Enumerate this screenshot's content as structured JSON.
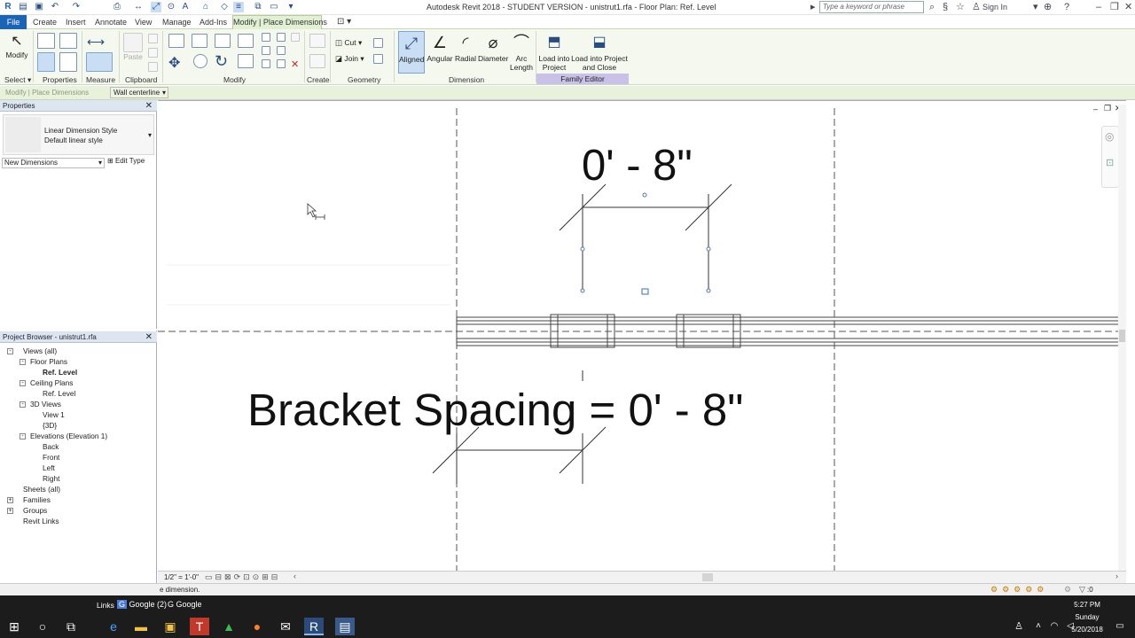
{
  "window": {
    "title": "Autodesk Revit 2018 - STUDENT VERSION -     unistrut1.rfa - Floor Plan: Ref. Level",
    "search_placeholder": "Type a keyword or phrase",
    "sign_in": "Sign In"
  },
  "tabs": [
    "File",
    "Create",
    "Insert",
    "Annotate",
    "View",
    "Manage",
    "Add-Ins",
    "Modify | Place Dimensions"
  ],
  "ribbon": {
    "panels": [
      "Select",
      "Properties",
      "Clipboard",
      "Modify",
      "Measure",
      "Create",
      "Geometry",
      "Dimension",
      "Family Editor"
    ],
    "buttons": {
      "modify": "Modify",
      "paste": "Paste",
      "cut": "Cut",
      "join": "Join",
      "aligned": "Aligned",
      "angular": "Angular",
      "radial": "Radial",
      "diameter": "Diameter",
      "arc_length": "Arc Length",
      "load_into_project": "Load into Project",
      "load_close": "Load into Project and Close"
    }
  },
  "options_bar": {
    "context": "Modify | Place Dimensions",
    "placement": "Wall centerline"
  },
  "properties": {
    "title": "Properties",
    "type_family": "Linear Dimension Style",
    "type_name": "Default linear style",
    "instance_selector": "New Dimensions",
    "edit_type": "Edit Type"
  },
  "project_browser": {
    "title": "Project Browser - unistrut1.rfa",
    "items": [
      {
        "label": "Views (all)",
        "level": 0,
        "expander": "-"
      },
      {
        "label": "Floor Plans",
        "level": 1,
        "expander": "-"
      },
      {
        "label": "Ref. Level",
        "level": 2,
        "bold": true
      },
      {
        "label": "Ceiling Plans",
        "level": 1,
        "expander": "-"
      },
      {
        "label": "Ref. Level",
        "level": 2
      },
      {
        "label": "3D Views",
        "level": 1,
        "expander": "-"
      },
      {
        "label": "View 1",
        "level": 2
      },
      {
        "label": "{3D}",
        "level": 2
      },
      {
        "label": "Elevations (Elevation 1)",
        "level": 1,
        "expander": "-"
      },
      {
        "label": "Back",
        "level": 2
      },
      {
        "label": "Front",
        "level": 2
      },
      {
        "label": "Left",
        "level": 2
      },
      {
        "label": "Right",
        "level": 2
      },
      {
        "label": "Sheets (all)",
        "level": 0
      },
      {
        "label": "Families",
        "level": 0,
        "expander": "+"
      },
      {
        "label": "Groups",
        "level": 0,
        "expander": "+"
      },
      {
        "label": "Revit Links",
        "level": 0
      }
    ]
  },
  "canvas": {
    "dimension_text": "0' - 8\"",
    "label_text": "Bracket Spacing = 0' - 8\""
  },
  "view_control": {
    "scale": "1/2\" = 1'-0\""
  },
  "status": {
    "message": "e dimension.",
    "selection_count": ":0"
  },
  "taskbar": {
    "links": "Links",
    "google_group": "Google (2)",
    "google": "Google",
    "time": "5:27 PM",
    "day": "Sunday",
    "date": "5/20/2018"
  }
}
